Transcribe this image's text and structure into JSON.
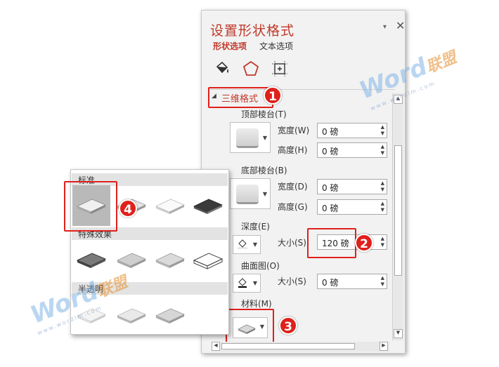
{
  "pane": {
    "title": "设置形状格式",
    "dropdown_icon": "▾",
    "close_icon": "✕",
    "tabs": [
      "形状选项",
      "文本选项"
    ],
    "icons": [
      "fill-line-icon",
      "effects-pentagon-icon",
      "size-properties-icon"
    ]
  },
  "section": {
    "arrow": "◢",
    "label": "三维格式"
  },
  "top_bevel": {
    "label": "顶部棱台(T)",
    "width_label": "宽度(W)",
    "width_value": "0 磅",
    "height_label": "高度(H)",
    "height_value": "0 磅"
  },
  "bottom_bevel": {
    "label": "底部棱台(B)",
    "width_label": "宽度(D)",
    "width_value": "0 磅",
    "height_label": "高度(G)",
    "height_value": "0 磅"
  },
  "depth": {
    "label": "深度(E)",
    "size_label": "大小(S)",
    "size_value": "120 磅"
  },
  "contour": {
    "label": "曲面图(O)",
    "size_label": "大小(S)",
    "size_value": "0 磅"
  },
  "material": {
    "label": "材料(M)"
  },
  "spin_arrows": {
    "up": "▲",
    "down": "▼"
  },
  "badges": [
    "1",
    "2",
    "3",
    "4"
  ],
  "gallery": {
    "sections": [
      "标准",
      "特殊效果",
      "半透明"
    ]
  },
  "watermark": {
    "brand": "Word",
    "brand_cn": "联盟",
    "url": "www.wordlm.com"
  },
  "colors": {
    "accent": "#c0392b",
    "highlight": "#e0201b",
    "pane_bg": "#f2f2f2"
  }
}
